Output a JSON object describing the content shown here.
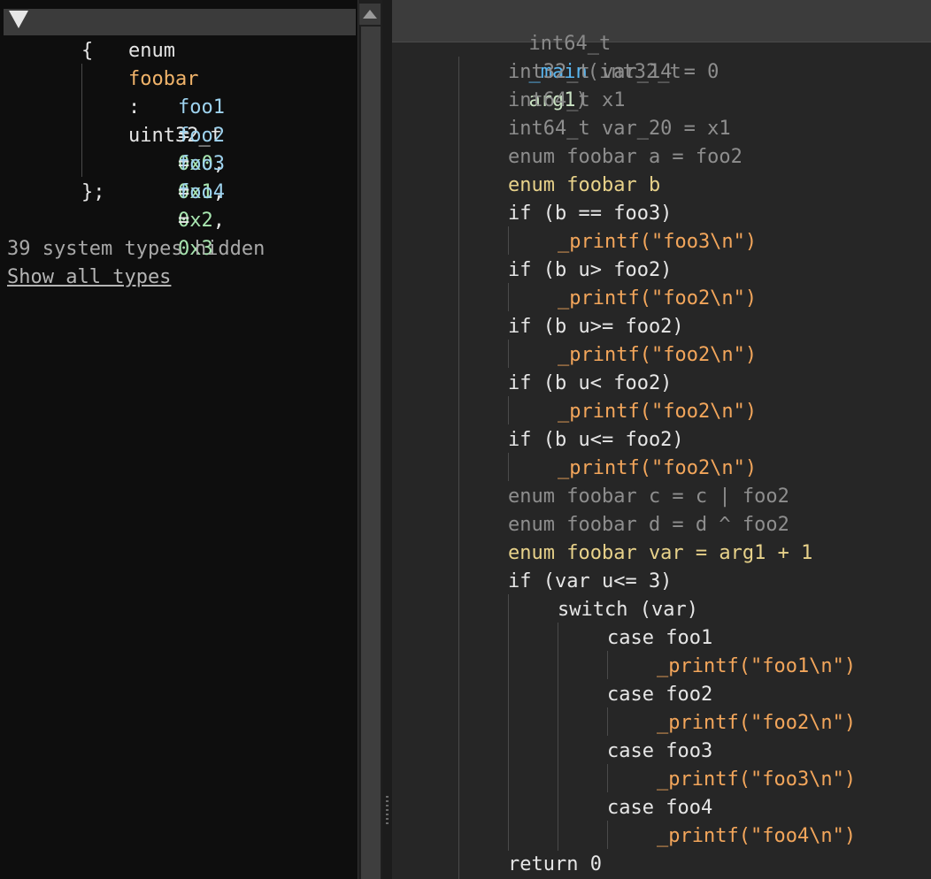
{
  "types_panel": {
    "enum_keyword": "enum",
    "enum_name": "foobar",
    "colon": ":",
    "base_type": "uint32_t",
    "open_brace": "{",
    "close_brace": "};",
    "members": [
      {
        "name": "foo1",
        "eq": "=",
        "value": "0x0",
        "sep": ","
      },
      {
        "name": "foo2",
        "eq": "=",
        "value": "0x1",
        "sep": ","
      },
      {
        "name": "foo3",
        "eq": "=",
        "value": "0x2",
        "sep": ","
      },
      {
        "name": "foo4",
        "eq": "=",
        "value": "0x3",
        "sep": ""
      }
    ],
    "hidden_status": "39 system types hidden",
    "show_all_link": "Show all types"
  },
  "code_panel": {
    "signature": {
      "ret_type": "int64_t",
      "func_name": "_main",
      "open": "(",
      "arg_type": "int32_t",
      "arg_name": "arg1",
      "close": ")"
    },
    "lines": [
      "int32_t var_14 = 0",
      "int64_t x1",
      "int64_t var_20 = x1",
      "enum foobar a = foo2",
      "enum foobar b",
      "if (b == foo3)",
      "_printf(\"foo3\\n\")",
      "if (b u> foo2)",
      "_printf(\"foo2\\n\")",
      "if (b u>= foo2)",
      "_printf(\"foo2\\n\")",
      "if (b u< foo2)",
      "_printf(\"foo2\\n\")",
      "if (b u<= foo2)",
      "_printf(\"foo2\\n\")",
      "enum foobar c = c | foo2",
      "enum foobar d = d ^ foo2",
      "enum foobar var = arg1 + 1",
      "if (var u<= 3)",
      "switch (var)",
      "case foo1",
      "_printf(\"foo1\\n\")",
      "case foo2",
      "_printf(\"foo2\\n\")",
      "case foo3",
      "_printf(\"foo3\\n\")",
      "case foo4",
      "_printf(\"foo4\\n\")",
      "return 0"
    ]
  },
  "colors": {
    "types_bg": "#0e0e0e",
    "code_bg": "#262626",
    "keyword": "#e6e6e6",
    "dimmed": "#8a8a8a",
    "type_name": "#f0b36a",
    "enum_member": "#e8d28a",
    "number": "#a8e6b0",
    "string": "#e7cfe0",
    "function": "#f3a65b",
    "main_function": "#5ab6f0"
  },
  "icons": {
    "collapse": "triangle-down-icon",
    "scroll_up": "scroll-up-arrow-icon",
    "splitter": "splitter-grip-icon"
  }
}
